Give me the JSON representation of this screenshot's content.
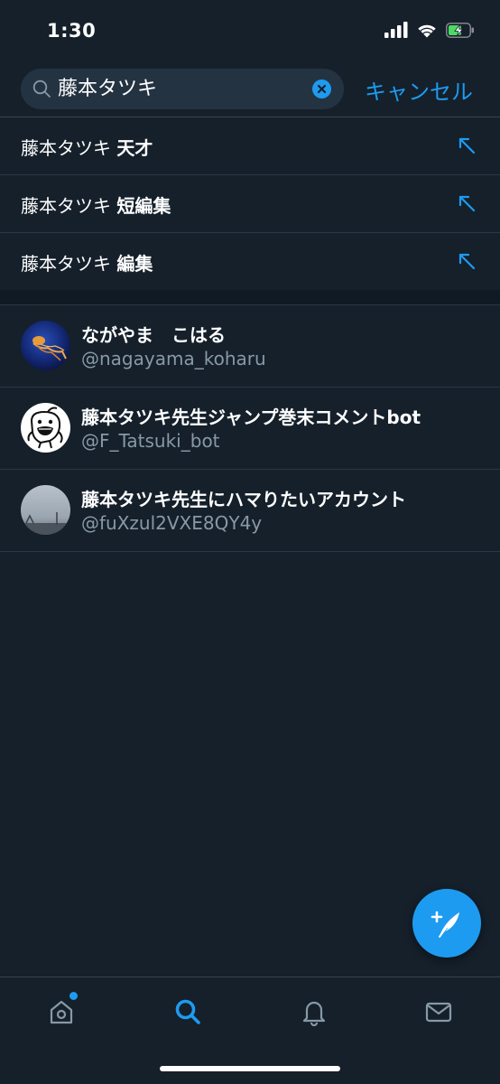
{
  "status_bar": {
    "time": "1:30"
  },
  "search": {
    "query": "藤本タツキ",
    "cancel_label": "キャンセル"
  },
  "suggestions": [
    {
      "prefix": "藤本タツキ ",
      "suffix": "天才"
    },
    {
      "prefix": "藤本タツキ ",
      "suffix": "短編集"
    },
    {
      "prefix": "藤本タツキ ",
      "suffix": "編集"
    }
  ],
  "users": [
    {
      "name": "ながやま　こはる",
      "handle": "@nagayama_koharu"
    },
    {
      "name": "藤本タツキ先生ジャンプ巻末コメントbot",
      "handle": "@F_Tatsuki_bot"
    },
    {
      "name": "藤本タツキ先生にハマりたいアカウント",
      "handle": "@fuXzul2VXE8QY4y"
    }
  ],
  "tabs": [
    {
      "icon": "home-icon",
      "active": false,
      "badge": true
    },
    {
      "icon": "search-icon",
      "active": true,
      "badge": false
    },
    {
      "icon": "bell-icon",
      "active": false,
      "badge": false
    },
    {
      "icon": "mail-icon",
      "active": false,
      "badge": false
    }
  ],
  "colors": {
    "background": "#15202b",
    "accent": "#1d9bf0",
    "secondary_text": "#8899a6",
    "battery": "#4cd964"
  }
}
